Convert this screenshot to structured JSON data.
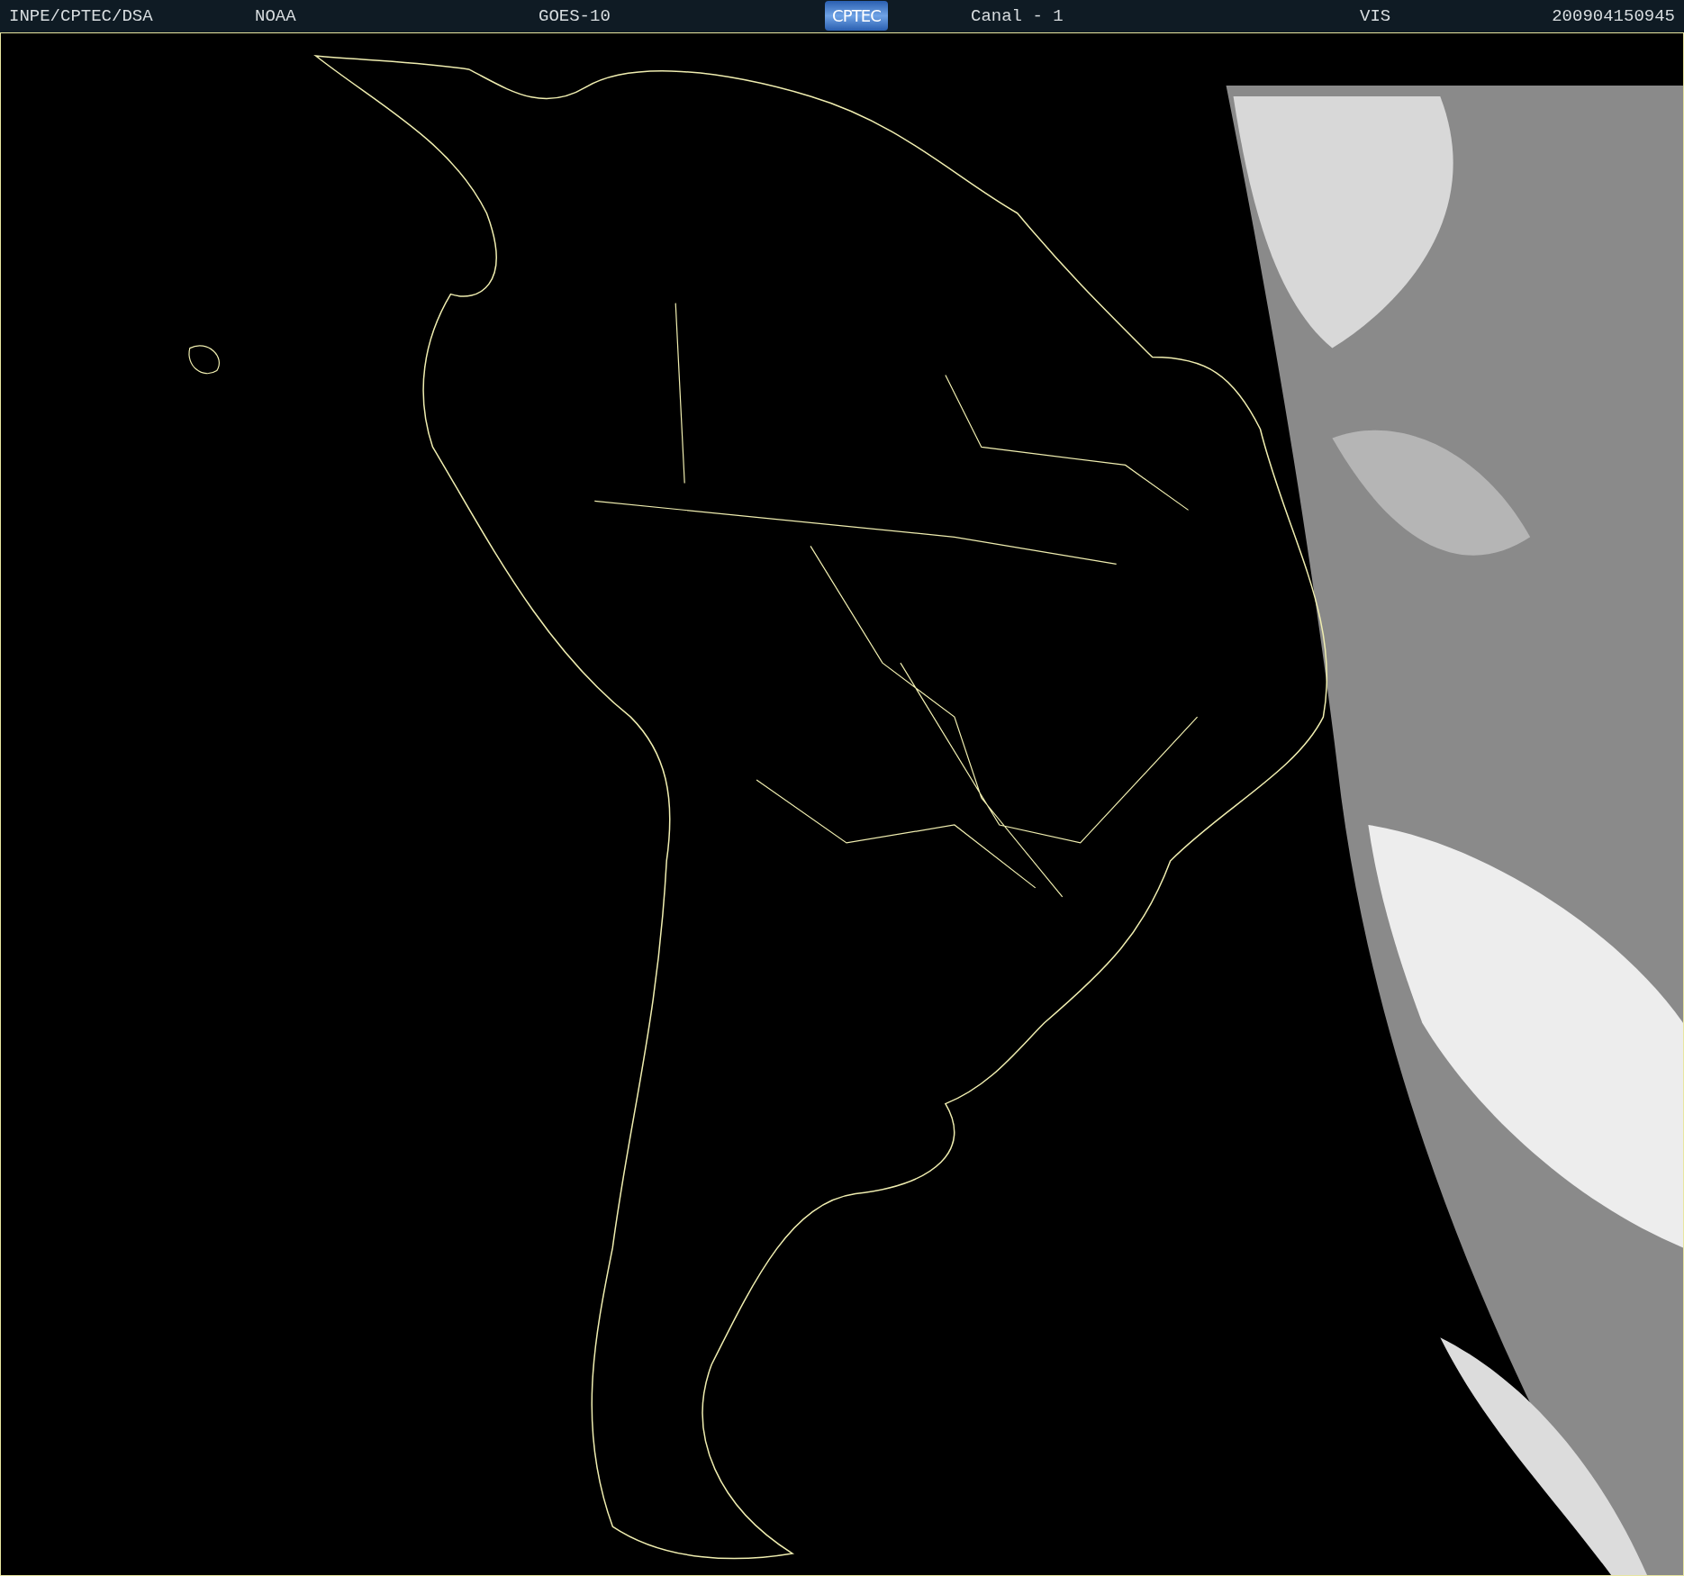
{
  "header": {
    "institution": "INPE/CPTEC/DSA",
    "agency": "NOAA",
    "satellite": "GOES-10",
    "logo": "CPTEC",
    "channel": "Canal - 1",
    "band": "VIS",
    "timestamp": "200904150945"
  }
}
